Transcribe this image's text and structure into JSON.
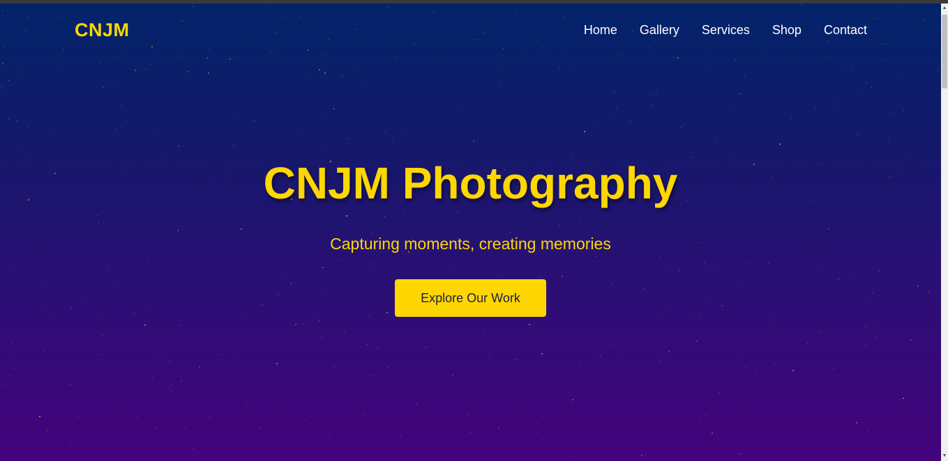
{
  "brand": {
    "logo_text": "CNJM",
    "accent_color": "#ffd700"
  },
  "nav": {
    "items": [
      {
        "label": "Home"
      },
      {
        "label": "Gallery"
      },
      {
        "label": "Services"
      },
      {
        "label": "Shop"
      },
      {
        "label": "Contact"
      }
    ]
  },
  "hero": {
    "title": "CNJM Photography",
    "subtitle": "Capturing moments, creating memories",
    "cta_label": "Explore Our Work"
  },
  "scrollbar": {
    "up_icon": "triangle-up",
    "down_icon": "triangle-down"
  }
}
